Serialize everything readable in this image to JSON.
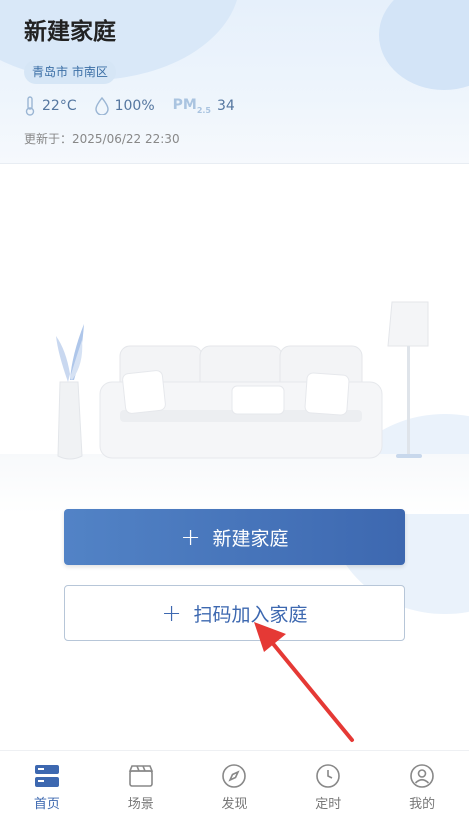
{
  "header": {
    "title": "新建家庭",
    "location": "青岛市 市南区",
    "temperature": "22°C",
    "humidity": "100%",
    "pm_label": "PM",
    "pm_sub": "2.5",
    "pm_value": "34",
    "updated_label": "更新于：",
    "updated_time": "2025/06/22 22:30"
  },
  "actions": {
    "new_home": "新建家庭",
    "scan_join": "扫码加入家庭",
    "plus": "+"
  },
  "tabs": [
    {
      "label": "首页",
      "icon": "home-icon",
      "active": true
    },
    {
      "label": "场景",
      "icon": "scene-icon",
      "active": false
    },
    {
      "label": "发现",
      "icon": "compass-icon",
      "active": false
    },
    {
      "label": "定时",
      "icon": "clock-icon",
      "active": false
    },
    {
      "label": "我的",
      "icon": "user-icon",
      "active": false
    }
  ],
  "colors": {
    "accent": "#3d68b0",
    "arrow": "#e53935"
  }
}
